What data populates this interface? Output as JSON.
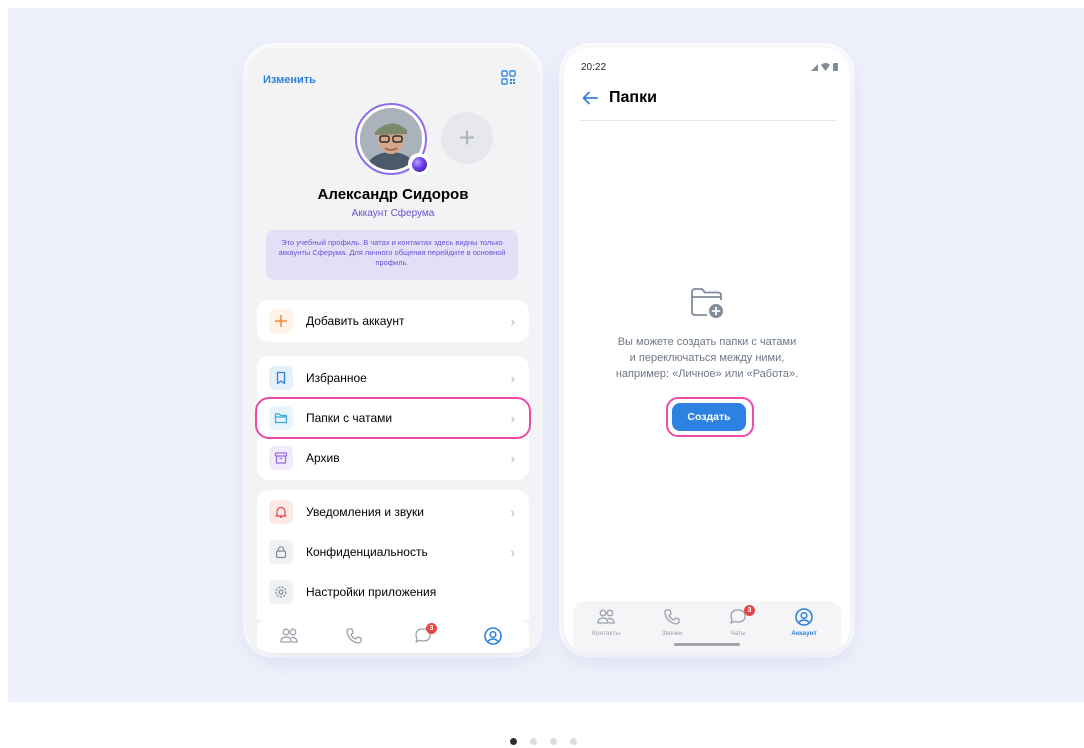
{
  "profile_screen": {
    "edit_label": "Изменить",
    "name": "Александр Сидоров",
    "account_type": "Аккаунт Сферума",
    "info_text": "Это учебный профиль. В чатах и контактах здесь видны только аккаунты Сферума. Для личного общения перейдите в основной профиль.",
    "add_account_label": "Добавить аккаунт",
    "menu_group_1": [
      {
        "label": "Избранное",
        "icon": "bookmark-icon"
      },
      {
        "label": "Папки с чатами",
        "icon": "folder-icon"
      },
      {
        "label": "Архив",
        "icon": "archive-icon"
      }
    ],
    "menu_group_2": [
      {
        "label": "Уведомления и звуки",
        "icon": "bell-icon"
      },
      {
        "label": "Конфиденциальность",
        "icon": "lock-icon"
      },
      {
        "label": "Настройки приложения",
        "icon": "gear-icon"
      }
    ],
    "chats_badge": "3"
  },
  "folders_screen": {
    "status_time": "20:22",
    "title": "Папки",
    "empty_text_line1": "Вы можете создать папки с чатами",
    "empty_text_line2": "и переключаться между ними,",
    "empty_text_line3": "например: «Личное» или «Работа».",
    "create_button": "Создать",
    "tabs": [
      {
        "label": "Контакты",
        "icon": "contacts-icon"
      },
      {
        "label": "Звонки",
        "icon": "phone-icon"
      },
      {
        "label": "Чаты",
        "icon": "chat-icon"
      },
      {
        "label": "Аккаунт",
        "icon": "account-icon"
      }
    ],
    "chats_badge": "3"
  },
  "carousel": {
    "total": 4,
    "active": 1
  },
  "colors": {
    "accent": "#2d81e0",
    "highlight": "#ec4aa8",
    "sferum_purple": "#6b51d6",
    "badge_red": "#e64646"
  }
}
